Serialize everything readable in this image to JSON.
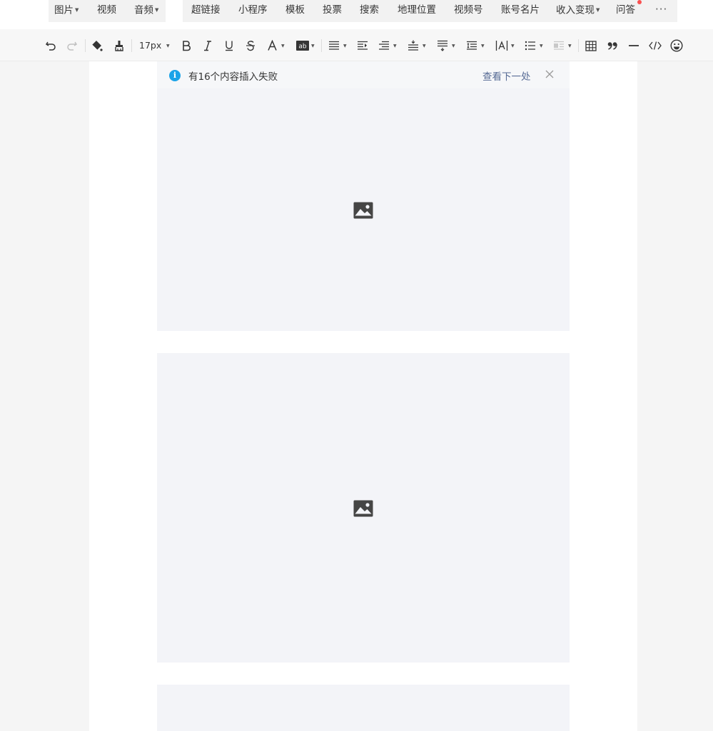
{
  "insert_menu": {
    "group1": [
      {
        "label": "图片",
        "dropdown": true
      },
      {
        "label": "视频",
        "dropdown": false
      },
      {
        "label": "音频",
        "dropdown": true
      }
    ],
    "group2": [
      {
        "label": "超链接",
        "dropdown": false
      },
      {
        "label": "小程序",
        "dropdown": false
      },
      {
        "label": "模板",
        "dropdown": false
      },
      {
        "label": "投票",
        "dropdown": false
      },
      {
        "label": "搜索",
        "dropdown": false
      },
      {
        "label": "地理位置",
        "dropdown": false
      },
      {
        "label": "视频号",
        "dropdown": false
      },
      {
        "label": "账号名片",
        "dropdown": false
      },
      {
        "label": "收入变现",
        "dropdown": true
      },
      {
        "label": "问答",
        "dropdown": false
      }
    ],
    "more_label": "···",
    "badge_color": "#fa5151"
  },
  "toolbar": {
    "font_size": "17px",
    "icons": [
      "undo-icon",
      "redo-icon",
      "format-painter-icon",
      "clear-format-icon",
      "bold-icon",
      "italic-icon",
      "underline-icon",
      "strikethrough-icon",
      "font-color-icon",
      "background-color-icon",
      "align-icon",
      "indent-icon",
      "first-line-indent-icon",
      "paragraph-spacing-before-icon",
      "paragraph-spacing-after-icon",
      "line-height-icon",
      "letter-spacing-icon",
      "list-icon",
      "float-icon",
      "table-icon",
      "quote-icon",
      "divider-icon",
      "code-icon",
      "emoji-icon"
    ]
  },
  "notice": {
    "icon_letter": "i",
    "text": "有16个内容插入失败",
    "link": "查看下一处",
    "accent_color": "#1aa3e8",
    "link_color": "#576b95"
  },
  "placeholders": {
    "icon": "image-placeholder-icon",
    "background": "#f3f4f8"
  }
}
